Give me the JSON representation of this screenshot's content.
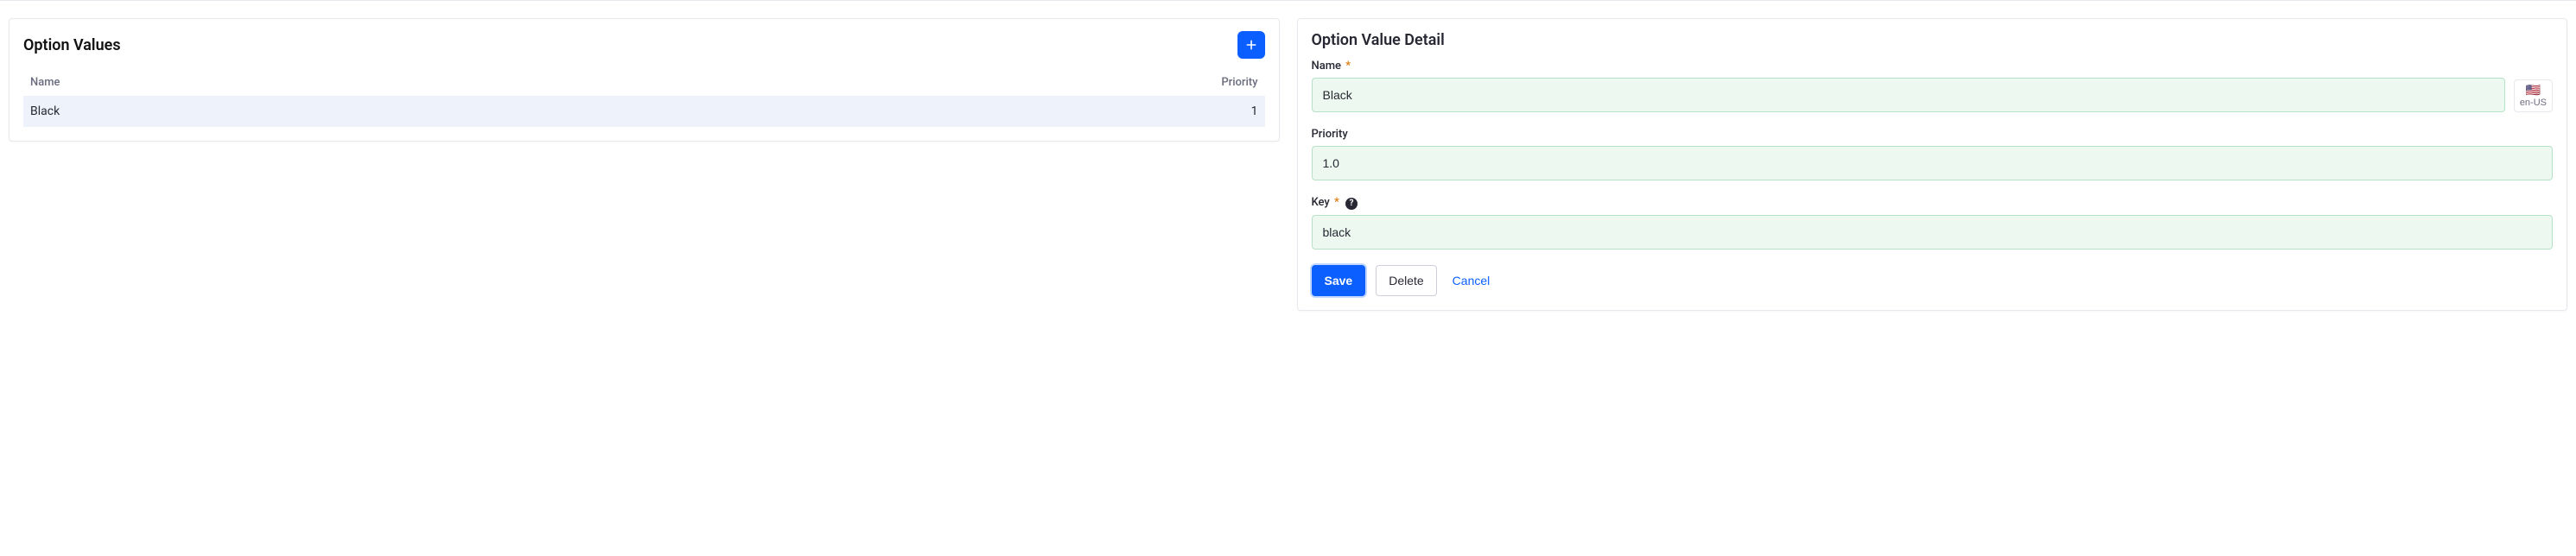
{
  "left_panel": {
    "title": "Option Values",
    "columns": {
      "name": "Name",
      "priority": "Priority"
    },
    "rows": [
      {
        "name": "Black",
        "priority": "1"
      }
    ]
  },
  "right_panel": {
    "title": "Option Value Detail",
    "locale": {
      "code": "en-US",
      "flag": "🇺🇸"
    },
    "fields": {
      "name": {
        "label": "Name",
        "value": "Black",
        "required": true
      },
      "priority": {
        "label": "Priority",
        "value": "1.0",
        "required": false
      },
      "key": {
        "label": "Key",
        "value": "black",
        "required": true,
        "help": "?"
      }
    },
    "actions": {
      "save": "Save",
      "delete": "Delete",
      "cancel": "Cancel"
    }
  }
}
